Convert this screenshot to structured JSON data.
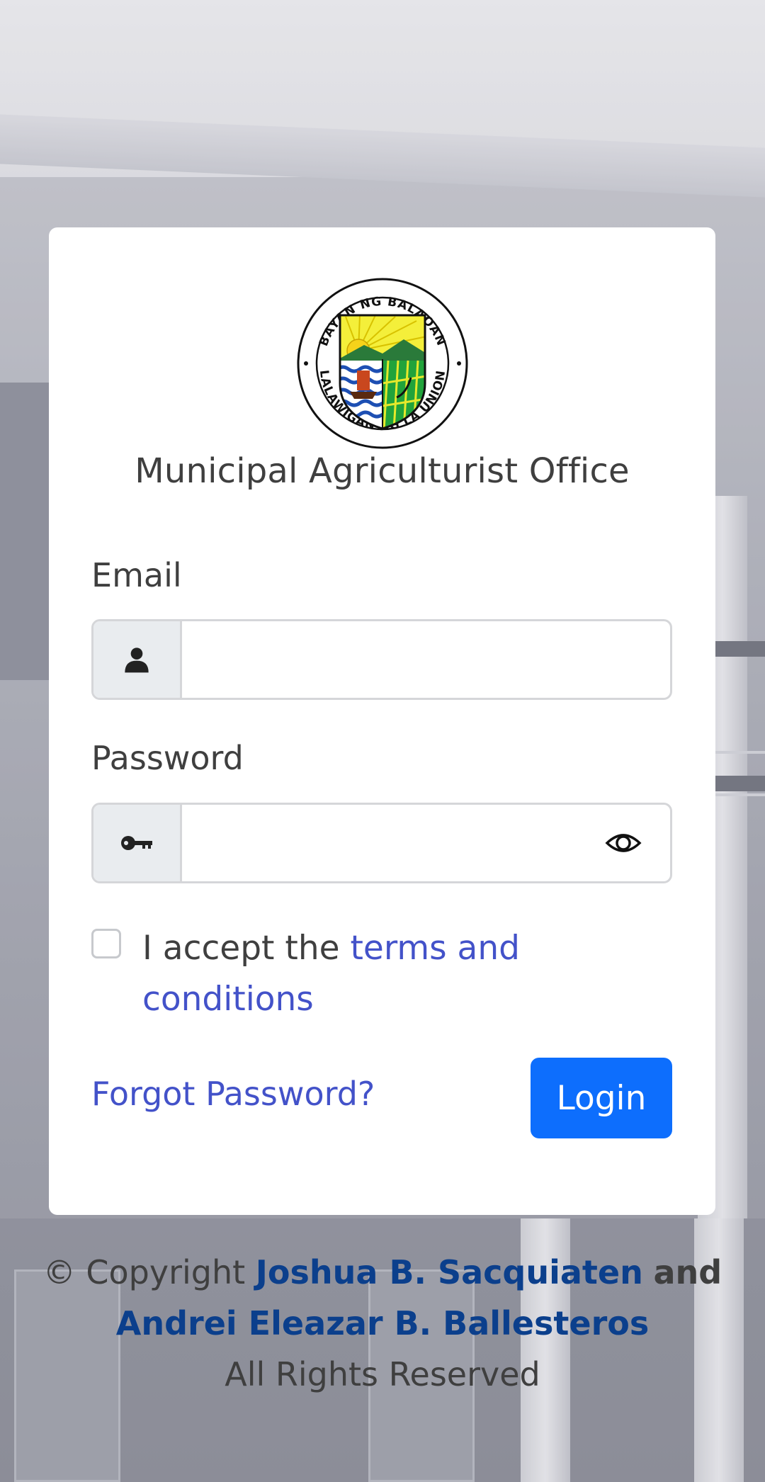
{
  "app": {
    "title": "Municipal Agriculturist Office",
    "logo": {
      "name": "seal-icon",
      "top_text": "BAYAN NG BALAOAN",
      "bottom_text": "LALAWIGAN NG LA UNION"
    }
  },
  "form": {
    "email": {
      "label": "Email",
      "value": "",
      "icon": "user-icon"
    },
    "password": {
      "label": "Password",
      "value": "",
      "icon": "key-icon",
      "toggle_icon": "eye-icon"
    },
    "terms": {
      "prefix": "I accept the",
      "link_text": "terms and conditions",
      "checked": false
    },
    "forgot_label": "Forgot Password?",
    "login_label": "Login"
  },
  "footer": {
    "copyright_prefix": "© Copyright",
    "author1": "Joshua B. Sacquiaten",
    "conjunction": "and",
    "author2": "Andrei Eleazar B. Ballesteros",
    "rights": "All Rights Reserved"
  },
  "colors": {
    "primary_button": "#0d6efd",
    "link": "#4352c9",
    "author": "#0b3f8c",
    "text": "#3f3f3f"
  }
}
